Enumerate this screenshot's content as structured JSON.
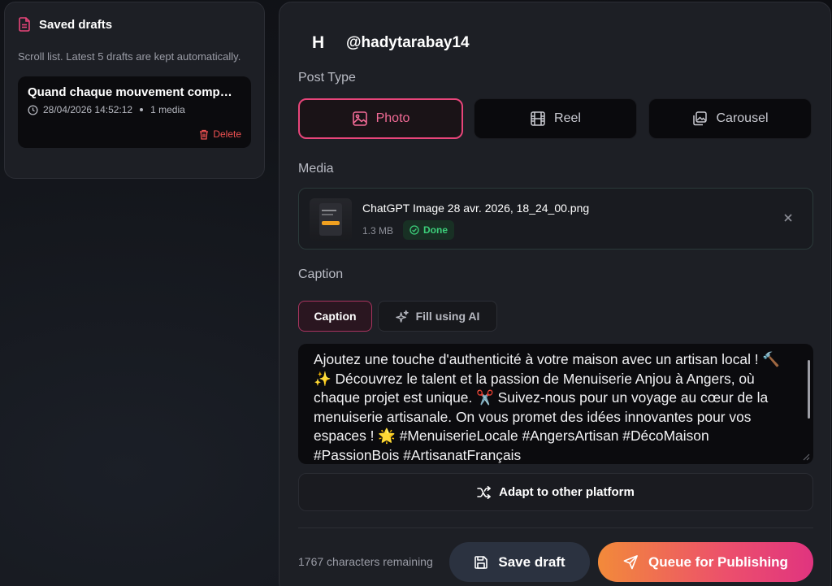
{
  "drafts": {
    "title": "Saved drafts",
    "subtitle": "Scroll list. Latest 5 drafts are kept automatically.",
    "items": [
      {
        "title": "Quand chaque mouvement comp…",
        "timestamp": "28/04/2026 14:52:12",
        "media_count": "1 media",
        "delete_label": "Delete"
      }
    ]
  },
  "account": {
    "avatar_initial": "H",
    "handle": "@hadytarabay14"
  },
  "post_type": {
    "label": "Post Type",
    "options": [
      {
        "label": "Photo",
        "icon": "image-icon",
        "selected": true
      },
      {
        "label": "Reel",
        "icon": "film-icon",
        "selected": false
      },
      {
        "label": "Carousel",
        "icon": "gallery-icon",
        "selected": false
      }
    ]
  },
  "media": {
    "label": "Media",
    "file_name": "ChatGPT Image 28 avr. 2026, 18_24_00.png",
    "file_size": "1.3 MB",
    "status": "Done"
  },
  "caption": {
    "label": "Caption",
    "tabs": {
      "caption": "Caption",
      "ai": "Fill using AI"
    },
    "text": "Ajoutez une touche d'authenticité à votre maison avec un artisan local ! 🔨 ✨ Découvrez le talent et la passion de Menuiserie Anjou à Angers, où chaque projet est unique. ✂️ Suivez-nous pour un voyage au cœur de la menuiserie artisanale. On vous promet des idées innovantes pour vos espaces ! 🌟 #MenuiserieLocale #AngersArtisan #DécoMaison #PassionBois #ArtisanatFrançais",
    "adapt_label": "Adapt to other platform",
    "chars_remaining": "1767 characters remaining"
  },
  "actions": {
    "save_label": "Save draft",
    "queue_label": "Queue for Publishing"
  },
  "colors": {
    "accent": "#e8457a",
    "success": "#3ccf7a",
    "danger": "#f05252"
  }
}
